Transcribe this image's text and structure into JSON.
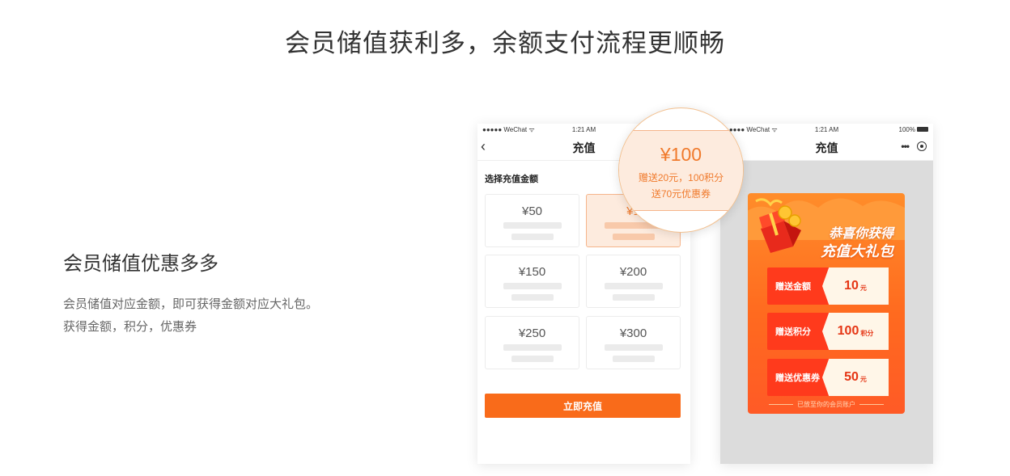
{
  "main_title": "会员储值获利多，余额支付流程更顺畅",
  "feature": {
    "heading": "会员储值优惠多多",
    "desc_line1": "会员储值对应金额，即可获得金额对应大礼包。",
    "desc_line2": "获得金额，积分，优惠券"
  },
  "left_phone": {
    "status": {
      "carrier": "●●●●● WeChat ᯤ",
      "time": "1:21 AM"
    },
    "nav_title": "充值",
    "back_icon": "‹",
    "section_label": "选择充值金额",
    "amounts": [
      "¥50",
      "¥1",
      "¥150",
      "¥200",
      "¥250",
      "¥300"
    ],
    "selected_index": 1,
    "recharge_button": "立即充值"
  },
  "magnifier": {
    "amount": "¥100",
    "line1": "赠送20元，100积分",
    "line2": "送70元优惠券"
  },
  "right_phone": {
    "status": {
      "carrier": "●●●●● WeChat ᯤ",
      "time": "1:21 AM",
      "battery": "100%"
    },
    "nav_title": "充值",
    "capsule_more": "•••",
    "gift": {
      "title_line1": "恭喜你获得",
      "title_line2": "充值大礼包",
      "rows": [
        {
          "label": "赠送金额",
          "value": "10",
          "unit": "元"
        },
        {
          "label": "赠送积分",
          "value": "100",
          "unit": "积分"
        },
        {
          "label": "赠送优惠券",
          "value": "50",
          "unit": "元"
        }
      ],
      "footer": "已放至你的会员账户"
    }
  },
  "colors": {
    "accent": "#f96b1a",
    "accent_light": "#fdebde",
    "gift_red": "#ff3a1c"
  }
}
